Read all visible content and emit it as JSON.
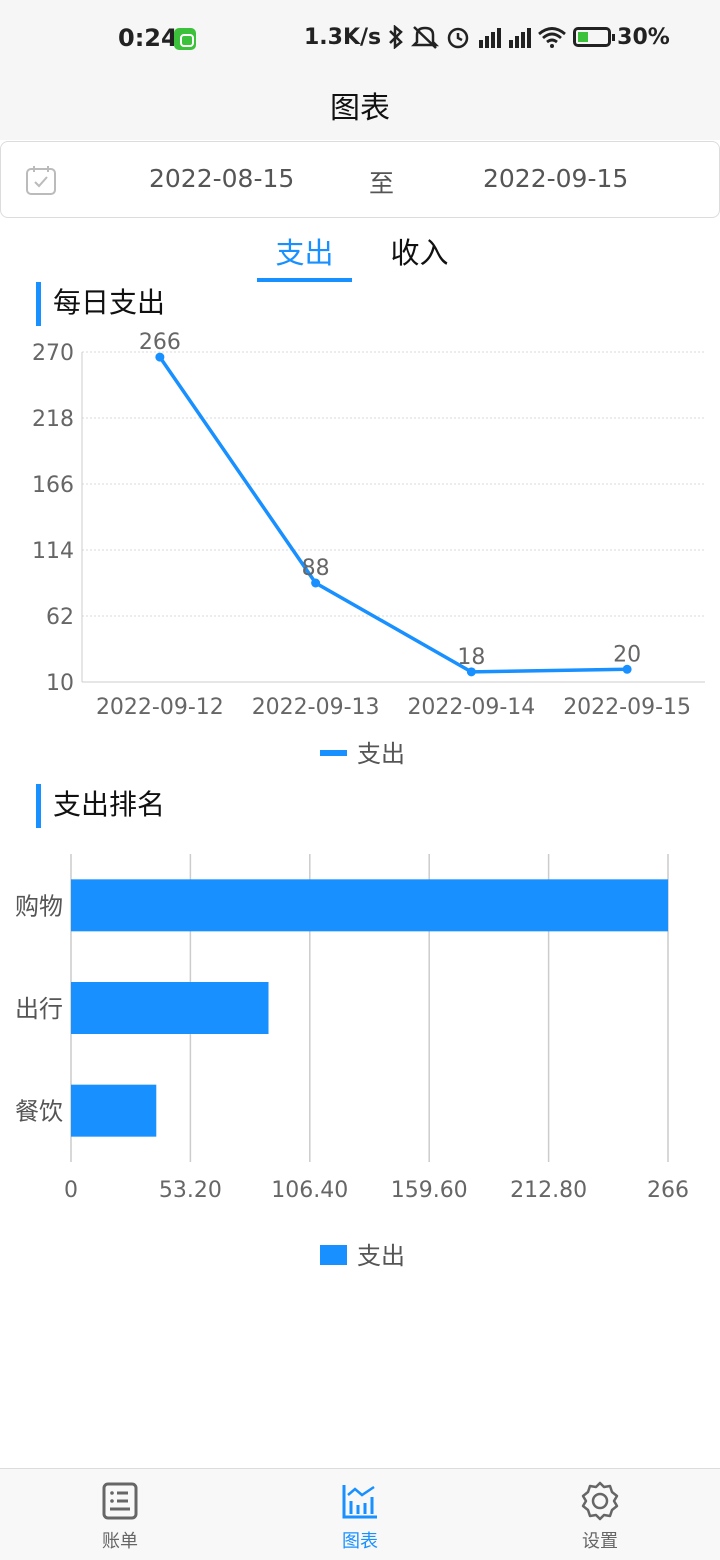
{
  "status_bar": {
    "time": "0:24",
    "network_speed": "1.3K/s",
    "battery_level": "30%",
    "icons": [
      "app-notification-icon",
      "bluetooth-icon",
      "mute-icon",
      "alarm-icon",
      "hd-signal-icon",
      "signal-icon",
      "wifi-icon",
      "battery-charging-icon"
    ]
  },
  "header": {
    "title": "图表"
  },
  "date_range": {
    "start": "2022-08-15",
    "separator": "至",
    "end": "2022-09-15",
    "icon": "calendar-icon"
  },
  "tabs": [
    {
      "label": "支出",
      "active": true
    },
    {
      "label": "收入",
      "active": false
    }
  ],
  "accent_color": "#1890ff",
  "daily_section": {
    "title": "每日支出"
  },
  "ranking_section": {
    "title": "支出排名"
  },
  "chart_data": [
    {
      "type": "line",
      "categories": [
        "2022-09-12",
        "2022-09-13",
        "2022-09-14",
        "2022-09-15"
      ],
      "series": [
        {
          "name": "支出",
          "values": [
            266,
            88,
            18,
            20
          ]
        }
      ],
      "ylim": [
        10,
        270
      ],
      "yticks": [
        "270",
        "218",
        "166",
        "114",
        "62",
        "10"
      ],
      "grid": true,
      "legend": "bottom-center",
      "color": "#1890ff"
    },
    {
      "type": "bar",
      "orientation": "horizontal",
      "categories": [
        "购物",
        "出行",
        "餐饮"
      ],
      "series": [
        {
          "name": "支出",
          "values": [
            266,
            88,
            38
          ]
        }
      ],
      "xlim": [
        0,
        266
      ],
      "xticks": [
        "0",
        "53.20",
        "106.40",
        "159.60",
        "212.80",
        "266"
      ],
      "grid": true,
      "legend": "bottom-center",
      "color": "#1890ff"
    }
  ],
  "bottom_nav": {
    "items": [
      {
        "label": "账单",
        "icon": "bill-icon",
        "active": false
      },
      {
        "label": "图表",
        "icon": "chart-icon",
        "active": true
      },
      {
        "label": "设置",
        "icon": "settings-icon",
        "active": false
      }
    ]
  }
}
